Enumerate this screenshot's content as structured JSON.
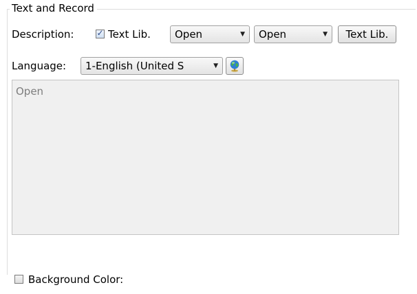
{
  "group": {
    "title": "Text and Record"
  },
  "description": {
    "label": "Description:",
    "textlib_checkbox_label": "Text Lib.",
    "textlib_checked": true,
    "combo1_value": "Open",
    "combo2_value": "Open",
    "textlib_button_label": "Text Lib."
  },
  "language": {
    "label": "Language:",
    "selected": "1-English (United S",
    "icon": "globe-icon"
  },
  "text_area": {
    "content": "Open"
  },
  "background": {
    "checkbox_label": "Background Color:",
    "checked": false
  }
}
